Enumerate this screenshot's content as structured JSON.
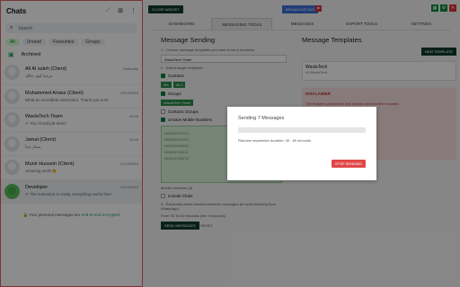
{
  "sidebar": {
    "title": "Chats",
    "search_placeholder": "Search",
    "filters": [
      "All",
      "Unread",
      "Favourites",
      "Groups"
    ],
    "archived": "Archived",
    "chats": [
      {
        "name": "Ali Al saleh (Client)",
        "time": "Yesterday",
        "preview": "مرحبا كيف حالك",
        "avatar": "gray"
      },
      {
        "name": "Muhammed Anass (Client)",
        "time": "25/10/2024",
        "preview": "What an incredible extension!, Thank you a lot",
        "avatar": "gray"
      },
      {
        "name": "WaslaTech Team",
        "time": "09:46",
        "preview": "✔ You: Good job team!",
        "avatar": "gray"
      },
      {
        "name": "Jamal (Client)",
        "time": "10:46",
        "preview": "ممتاز جداً",
        "avatar": "gray"
      },
      {
        "name": "Munir Hussein (Client)",
        "time": "21/10/2024",
        "preview": "Amazing work!👏",
        "avatar": "gray"
      },
      {
        "name": "Developer",
        "time": "22/10/2024",
        "preview": "✔ The extension is ready, everything works fine!",
        "avatar": "green"
      }
    ],
    "footer_prefix": "🔒 Your personal messages are ",
    "footer_link": "end-to-end encrypted"
  },
  "main": {
    "top_btn": "CLOSE WIDGET",
    "blue_btn": "BROADCASTING",
    "tabs": [
      "DASHBOARD",
      "MESSAGING TOOLS",
      "MESSAGES",
      "EXPORT TOOLS",
      "SETTINGS"
    ],
    "left": {
      "title": "Message Sending",
      "choose": "1 - Choose message templates you want to send randomly",
      "template": "WaslaTech Team",
      "select_recipients": "2 - Select target recipients",
      "contacts": "Contacts",
      "tag1": "Me",
      "tag2": "All 3",
      "groups": "Groups",
      "tag3": "WaslaTech Team",
      "contact_groups": "Contacts Groups",
      "unsaved": "Unsave Mobile Numbers",
      "numbers": [
        "966502502502",
        "966500000000",
        "966555555555",
        "966598765432",
        "966512345678"
      ],
      "mobile_count": "Mobile Numbers (5)",
      "include_chats": "Include Chats",
      "delay_label": "3 - Randomly select duration between messages (to avoid blocking from WhatsApp)",
      "from": "From",
      "from_val": "30",
      "to": "To",
      "to_val": "60",
      "unit": "Seconds (min 5 seconds)",
      "send": "SEND MESSAGES",
      "reset": "RESET"
    },
    "right": {
      "title": "Message Templates",
      "new_btn": "NEW TEMPLATE",
      "tpl_name": "WaslaTech",
      "tpl_sub": "Hi WaslaTech",
      "disclaimer": "DISCLAIMER",
      "disc_text": "The features provided in this service are intended to assist..."
    }
  },
  "modal": {
    "title": "Sending 7 Messages",
    "note": "Random separation duration: 30 - 60 seconds",
    "stop": "STOP SENDING"
  }
}
